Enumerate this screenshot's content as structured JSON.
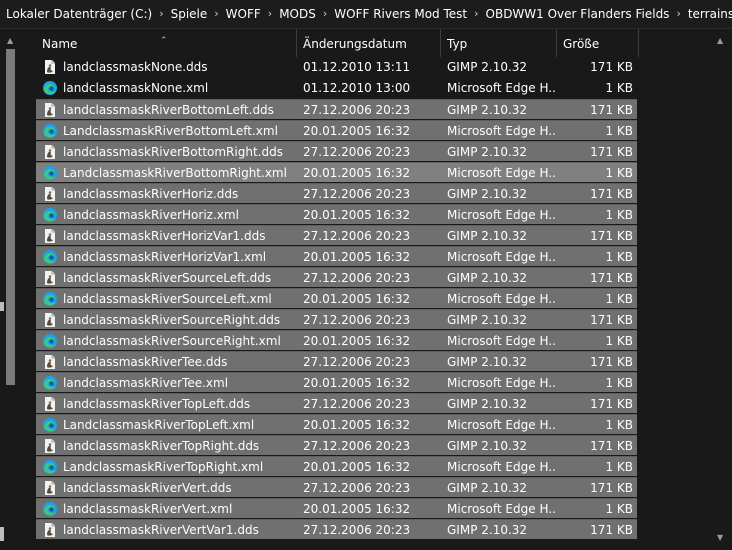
{
  "breadcrumb": [
    "Lokaler Datenträger (C:)",
    "Spiele",
    "WOFF",
    "MODS",
    "WOFF Rivers Mod Test",
    "OBDWW1 Over Flanders Fields",
    "terrains"
  ],
  "breadcrumb_separator": "›",
  "columns": {
    "name": "Name",
    "date": "Änderungsdatum",
    "type": "Typ",
    "size": "Größe"
  },
  "sort_caret": "⌃",
  "scroll_up": "▲",
  "scroll_down": "▼",
  "colors": {
    "background": "#191919",
    "selected_row": "#707070",
    "focused_row": "#808080",
    "edge_icon_blue": "#1aa3e8",
    "edge_icon_green": "#3fc87a"
  },
  "files": [
    {
      "name": "landclassmaskNone.dds",
      "date": "01.12.2010 13:11",
      "type": "GIMP 2.10.32",
      "size": "171 KB",
      "icon": "gimp-file-icon",
      "state": "plain"
    },
    {
      "name": "landclassmaskNone.xml",
      "date": "01.12.2010 13:00",
      "type": "Microsoft Edge H...",
      "size": "1 KB",
      "icon": "edge-file-icon",
      "state": "plain"
    },
    {
      "name": "landclassmaskRiverBottomLeft.dds",
      "date": "27.12.2006 20:23",
      "type": "GIMP 2.10.32",
      "size": "171 KB",
      "icon": "gimp-file-icon",
      "state": "sel"
    },
    {
      "name": "LandclassmaskRiverBottomLeft.xml",
      "date": "20.01.2005 16:32",
      "type": "Microsoft Edge H...",
      "size": "1 KB",
      "icon": "edge-file-icon",
      "state": "sel"
    },
    {
      "name": "landclassmaskRiverBottomRight.dds",
      "date": "27.12.2006 20:23",
      "type": "GIMP 2.10.32",
      "size": "171 KB",
      "icon": "gimp-file-icon",
      "state": "sel"
    },
    {
      "name": "LandclassmaskRiverBottomRight.xml",
      "date": "20.01.2005 16:32",
      "type": "Microsoft Edge H...",
      "size": "1 KB",
      "icon": "edge-file-icon",
      "state": "focus"
    },
    {
      "name": "landclassmaskRiverHoriz.dds",
      "date": "27.12.2006 20:23",
      "type": "GIMP 2.10.32",
      "size": "171 KB",
      "icon": "gimp-file-icon",
      "state": "sel"
    },
    {
      "name": "landclassmaskRiverHoriz.xml",
      "date": "20.01.2005 16:32",
      "type": "Microsoft Edge H...",
      "size": "1 KB",
      "icon": "edge-file-icon",
      "state": "sel"
    },
    {
      "name": "landclassmaskRiverHorizVar1.dds",
      "date": "27.12.2006 20:23",
      "type": "GIMP 2.10.32",
      "size": "171 KB",
      "icon": "gimp-file-icon",
      "state": "sel"
    },
    {
      "name": "landclassmaskRiverHorizVar1.xml",
      "date": "20.01.2005 16:32",
      "type": "Microsoft Edge H...",
      "size": "1 KB",
      "icon": "edge-file-icon",
      "state": "sel"
    },
    {
      "name": "landclassmaskRiverSourceLeft.dds",
      "date": "27.12.2006 20:23",
      "type": "GIMP 2.10.32",
      "size": "171 KB",
      "icon": "gimp-file-icon",
      "state": "sel"
    },
    {
      "name": "landclassmaskRiverSourceLeft.xml",
      "date": "20.01.2005 16:32",
      "type": "Microsoft Edge H...",
      "size": "1 KB",
      "icon": "edge-file-icon",
      "state": "sel"
    },
    {
      "name": "landclassmaskRiverSourceRight.dds",
      "date": "27.12.2006 20:23",
      "type": "GIMP 2.10.32",
      "size": "171 KB",
      "icon": "gimp-file-icon",
      "state": "sel"
    },
    {
      "name": "landclassmaskRiverSourceRight.xml",
      "date": "20.01.2005 16:32",
      "type": "Microsoft Edge H...",
      "size": "1 KB",
      "icon": "edge-file-icon",
      "state": "sel"
    },
    {
      "name": "landclassmaskRiverTee.dds",
      "date": "27.12.2006 20:23",
      "type": "GIMP 2.10.32",
      "size": "171 KB",
      "icon": "gimp-file-icon",
      "state": "sel"
    },
    {
      "name": "landclassmaskRiverTee.xml",
      "date": "20.01.2005 16:32",
      "type": "Microsoft Edge H...",
      "size": "1 KB",
      "icon": "edge-file-icon",
      "state": "sel"
    },
    {
      "name": "landclassmaskRiverTopLeft.dds",
      "date": "27.12.2006 20:23",
      "type": "GIMP 2.10.32",
      "size": "171 KB",
      "icon": "gimp-file-icon",
      "state": "sel"
    },
    {
      "name": "LandclassmaskRiverTopLeft.xml",
      "date": "20.01.2005 16:32",
      "type": "Microsoft Edge H...",
      "size": "1 KB",
      "icon": "edge-file-icon",
      "state": "sel"
    },
    {
      "name": "landclassmaskRiverTopRight.dds",
      "date": "27.12.2006 20:23",
      "type": "GIMP 2.10.32",
      "size": "171 KB",
      "icon": "gimp-file-icon",
      "state": "sel"
    },
    {
      "name": "LandclassmaskRiverTopRight.xml",
      "date": "20.01.2005 16:32",
      "type": "Microsoft Edge H...",
      "size": "1 KB",
      "icon": "edge-file-icon",
      "state": "sel"
    },
    {
      "name": "landclassmaskRiverVert.dds",
      "date": "27.12.2006 20:23",
      "type": "GIMP 2.10.32",
      "size": "171 KB",
      "icon": "gimp-file-icon",
      "state": "sel"
    },
    {
      "name": "landclassmaskRiverVert.xml",
      "date": "20.01.2005 16:32",
      "type": "Microsoft Edge H...",
      "size": "1 KB",
      "icon": "edge-file-icon",
      "state": "sel"
    },
    {
      "name": "landclassmaskRiverVertVar1.dds",
      "date": "27.12.2006 20:23",
      "type": "GIMP 2.10.32",
      "size": "171 KB",
      "icon": "gimp-file-icon",
      "state": "sel"
    }
  ]
}
